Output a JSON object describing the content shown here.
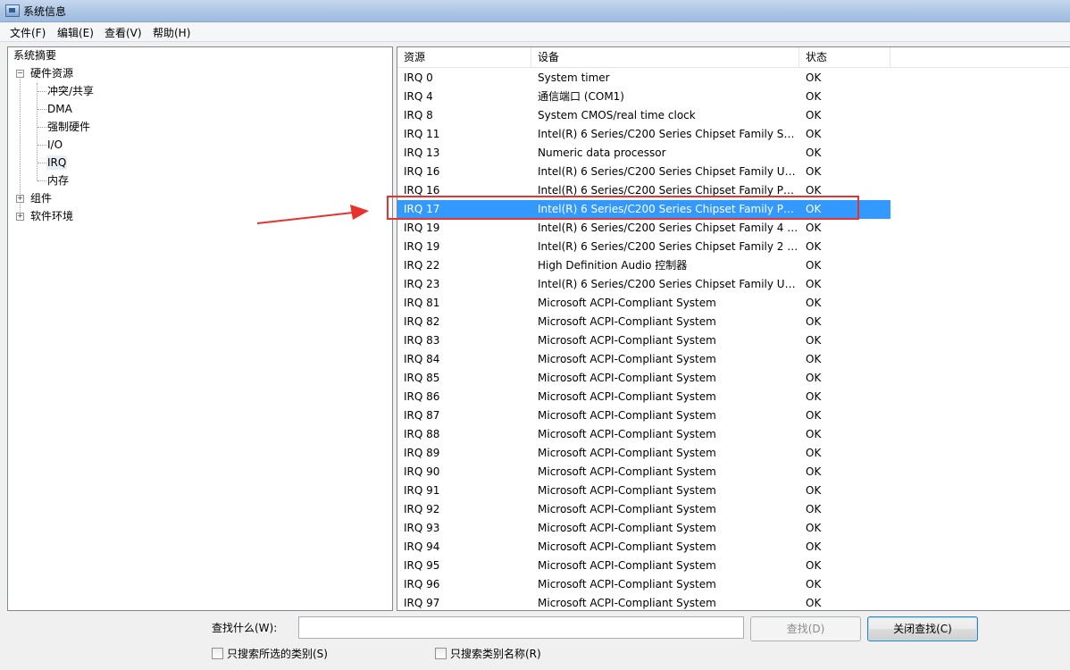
{
  "window": {
    "title": "系统信息"
  },
  "menu": [
    "文件(F)",
    "编辑(E)",
    "查看(V)",
    "帮助(H)"
  ],
  "tree": {
    "root": "系统摘要",
    "hardware": "硬件资源",
    "hardware_children": [
      "冲突/共享",
      "DMA",
      "强制硬件",
      "I/O",
      "IRQ",
      "内存"
    ],
    "selected": "IRQ",
    "components": "组件",
    "software": "软件环境"
  },
  "list": {
    "columns": [
      "资源",
      "设备",
      "状态"
    ],
    "selected_index": 7,
    "rows": [
      [
        "IRQ 0",
        "System timer",
        "OK"
      ],
      [
        "IRQ 4",
        "通信端口 (COM1)",
        "OK"
      ],
      [
        "IRQ 8",
        "System CMOS/real time clock",
        "OK"
      ],
      [
        "IRQ 11",
        "Intel(R) 6 Series/C200 Series Chipset Family SM...",
        "OK"
      ],
      [
        "IRQ 13",
        "Numeric data processor",
        "OK"
      ],
      [
        "IRQ 16",
        "Intel(R) 6 Series/C200 Series Chipset Family USB...",
        "OK"
      ],
      [
        "IRQ 16",
        "Intel(R) 6 Series/C200 Series Chipset Family PCI ...",
        "OK"
      ],
      [
        "IRQ 17",
        "Intel(R) 6 Series/C200 Series Chipset Family PCI ...",
        "OK"
      ],
      [
        "IRQ 19",
        "Intel(R) 6 Series/C200 Series Chipset Family 4 p...",
        "OK"
      ],
      [
        "IRQ 19",
        "Intel(R) 6 Series/C200 Series Chipset Family 2 p...",
        "OK"
      ],
      [
        "IRQ 22",
        "High Definition Audio 控制器",
        "OK"
      ],
      [
        "IRQ 23",
        "Intel(R) 6 Series/C200 Series Chipset Family USB...",
        "OK"
      ],
      [
        "IRQ 81",
        "Microsoft ACPI-Compliant System",
        "OK"
      ],
      [
        "IRQ 82",
        "Microsoft ACPI-Compliant System",
        "OK"
      ],
      [
        "IRQ 83",
        "Microsoft ACPI-Compliant System",
        "OK"
      ],
      [
        "IRQ 84",
        "Microsoft ACPI-Compliant System",
        "OK"
      ],
      [
        "IRQ 85",
        "Microsoft ACPI-Compliant System",
        "OK"
      ],
      [
        "IRQ 86",
        "Microsoft ACPI-Compliant System",
        "OK"
      ],
      [
        "IRQ 87",
        "Microsoft ACPI-Compliant System",
        "OK"
      ],
      [
        "IRQ 88",
        "Microsoft ACPI-Compliant System",
        "OK"
      ],
      [
        "IRQ 89",
        "Microsoft ACPI-Compliant System",
        "OK"
      ],
      [
        "IRQ 90",
        "Microsoft ACPI-Compliant System",
        "OK"
      ],
      [
        "IRQ 91",
        "Microsoft ACPI-Compliant System",
        "OK"
      ],
      [
        "IRQ 92",
        "Microsoft ACPI-Compliant System",
        "OK"
      ],
      [
        "IRQ 93",
        "Microsoft ACPI-Compliant System",
        "OK"
      ],
      [
        "IRQ 94",
        "Microsoft ACPI-Compliant System",
        "OK"
      ],
      [
        "IRQ 95",
        "Microsoft ACPI-Compliant System",
        "OK"
      ],
      [
        "IRQ 96",
        "Microsoft ACPI-Compliant System",
        "OK"
      ],
      [
        "IRQ 97",
        "Microsoft ACPI-Compliant System",
        "OK"
      ]
    ]
  },
  "find": {
    "label": "查找什么(W):",
    "value": "",
    "find_button": "查找(D)",
    "close_button": "关闭查找(C)",
    "check_selected_only": "只搜索所选的类别(S)",
    "check_names_only": "只搜索类别名称(R)"
  },
  "annotation": {
    "box_color": "#e8322d",
    "arrow_color": "#e8322d"
  },
  "colors": {
    "selection": "#3399ff"
  }
}
